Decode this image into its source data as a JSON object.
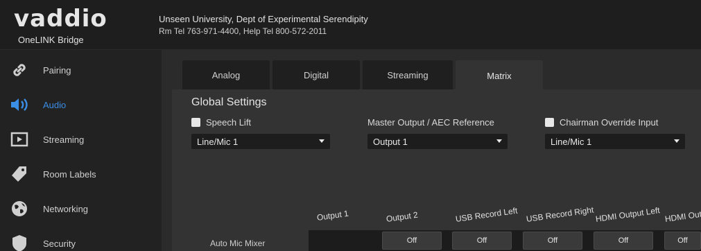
{
  "header": {
    "logo_word": "vaddio",
    "logo_subtitle": "OneLINK Bridge",
    "org_name": "Unseen University, Dept of Experimental Serendipity",
    "org_phone": "Rm Tel 763-971-4400, Help Tel 800-572-2011"
  },
  "sidebar": {
    "items": [
      {
        "label": "Pairing",
        "icon": "link-icon"
      },
      {
        "label": "Audio",
        "icon": "speaker-icon",
        "active": true
      },
      {
        "label": "Streaming",
        "icon": "play-icon"
      },
      {
        "label": "Room Labels",
        "icon": "tag-icon"
      },
      {
        "label": "Networking",
        "icon": "globe-icon"
      },
      {
        "label": "Security",
        "icon": "shield-icon"
      }
    ]
  },
  "tabs": [
    {
      "label": "Analog"
    },
    {
      "label": "Digital"
    },
    {
      "label": "Streaming"
    },
    {
      "label": "Matrix",
      "active": true
    }
  ],
  "global_settings": {
    "title": "Global Settings",
    "speech_lift_label": "Speech Lift",
    "speech_lift_value": "Line/Mic 1",
    "master_output_label": "Master Output / AEC Reference",
    "master_output_value": "Output 1",
    "chairman_label": "Chairman Override Input",
    "chairman_value": "Line/Mic 1"
  },
  "matrix": {
    "columns": [
      "Output 1",
      "Output 2",
      "USB Record Left",
      "USB Record Right",
      "HDMI Output Left",
      "HDMI Output Right"
    ],
    "row_label": "Auto Mic Mixer",
    "cells": [
      "Off",
      "Off",
      "Off",
      "Off",
      "Off"
    ]
  },
  "colors": {
    "accent": "#3a8ee6",
    "background": "#1b1b1b",
    "panel": "#333333"
  }
}
